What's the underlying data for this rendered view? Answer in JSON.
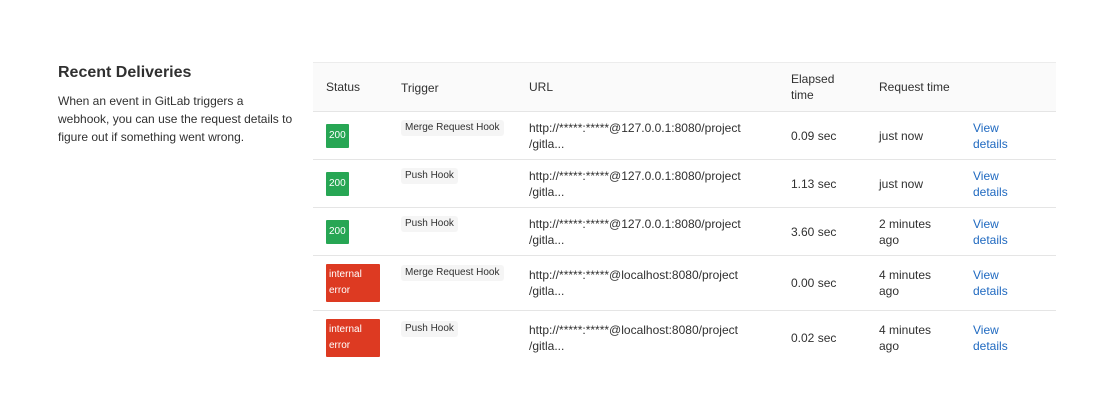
{
  "section": {
    "title": "Recent Deliveries",
    "description": "When an event in GitLab triggers a webhook, you can use the request details to figure out if something went wrong."
  },
  "table": {
    "headers": {
      "status": "Status",
      "trigger": "Trigger",
      "url": "URL",
      "elapsed_line1": "Elapsed",
      "elapsed_line2": "time",
      "request_time": "Request time"
    },
    "rows": [
      {
        "status": "200",
        "status_kind": "success",
        "trigger": "Merge Request Hook",
        "url_line1": "http://*****:*****@127.0.0.1:8080/project",
        "url_line2": "/gitla...",
        "elapsed": "0.09 sec",
        "request_time_line1": "just now",
        "request_time_line2": "",
        "link_line1": "View",
        "link_line2": "details"
      },
      {
        "status": "200",
        "status_kind": "success",
        "trigger": "Push Hook",
        "url_line1": "http://*****:*****@127.0.0.1:8080/project",
        "url_line2": "/gitla...",
        "elapsed": "1.13 sec",
        "request_time_line1": "just now",
        "request_time_line2": "",
        "link_line1": "View",
        "link_line2": "details"
      },
      {
        "status": "200",
        "status_kind": "success",
        "trigger": "Push Hook",
        "url_line1": "http://*****:*****@127.0.0.1:8080/project",
        "url_line2": "/gitla...",
        "elapsed": "3.60 sec",
        "request_time_line1": "2 minutes",
        "request_time_line2": "ago",
        "link_line1": "View",
        "link_line2": "details"
      },
      {
        "status_line1": "internal",
        "status_line2": "error",
        "status_kind": "error",
        "trigger": "Merge Request Hook",
        "url_line1": "http://*****:*****@localhost:8080/project",
        "url_line2": "/gitla...",
        "elapsed": "0.00 sec",
        "request_time_line1": "4 minutes",
        "request_time_line2": "ago",
        "link_line1": "View",
        "link_line2": "details"
      },
      {
        "status_line1": "internal",
        "status_line2": "error",
        "status_kind": "error",
        "trigger": "Push Hook",
        "url_line1": "http://*****:*****@localhost:8080/project",
        "url_line2": "/gitla...",
        "elapsed": "0.02 sec",
        "request_time_line1": "4 minutes",
        "request_time_line2": "ago",
        "link_line1": "View",
        "link_line2": "details"
      }
    ]
  },
  "colors": {
    "success": "#27a654",
    "error": "#dd3a22",
    "link": "#1f69c0"
  }
}
